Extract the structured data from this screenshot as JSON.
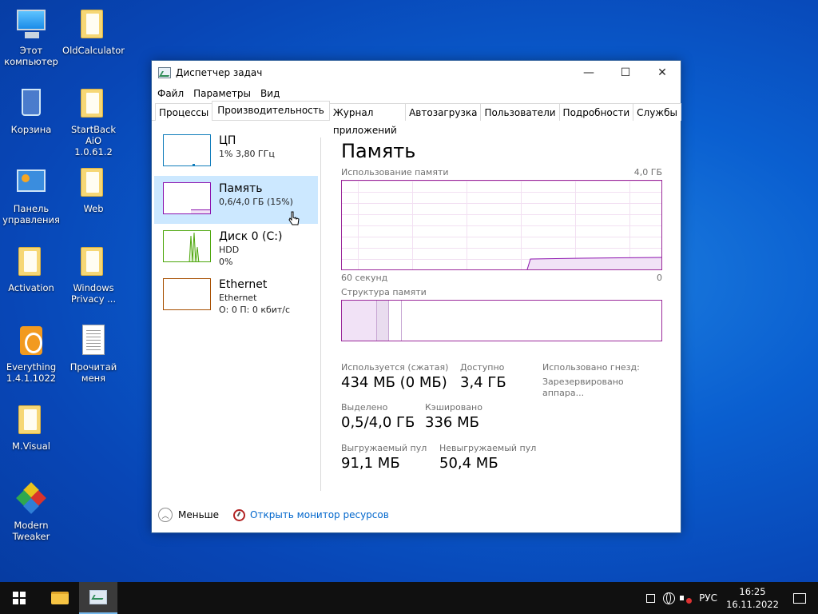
{
  "desktop": {
    "icons": [
      {
        "label_1": "Этот",
        "label_2": "компьютер"
      },
      {
        "label_1": "OldCalculator",
        "label_2": ""
      },
      {
        "label_1": "Корзина",
        "label_2": ""
      },
      {
        "label_1": "StartBack AiO",
        "label_2": "1.0.61.2"
      },
      {
        "label_1": "Панель",
        "label_2": "управления"
      },
      {
        "label_1": "Web",
        "label_2": ""
      },
      {
        "label_1": "Activation",
        "label_2": ""
      },
      {
        "label_1": "Windows",
        "label_2": "Privacy ..."
      },
      {
        "label_1": "Everything",
        "label_2": "1.4.1.1022"
      },
      {
        "label_1": "Прочитай",
        "label_2": "меня"
      },
      {
        "label_1": "M.Visual",
        "label_2": ""
      },
      {
        "label_1": "Modern",
        "label_2": "Tweaker"
      }
    ]
  },
  "window": {
    "title": "Диспетчер задач",
    "menu": [
      "Файл",
      "Параметры",
      "Вид"
    ],
    "tabs": [
      "Процессы",
      "Производительность",
      "Журнал приложений",
      "Автозагрузка",
      "Пользователи",
      "Подробности",
      "Службы"
    ],
    "active_tab": "Производительность",
    "controls": {
      "minimize": "—",
      "maximize": "☐",
      "close": "✕"
    }
  },
  "sidebar": {
    "items": [
      {
        "name": "ЦП",
        "sub1": "1% 3,80 ГГц",
        "sub2": "",
        "color": "#117dbb"
      },
      {
        "name": "Память",
        "sub1": "0,6/4,0 ГБ (15%)",
        "sub2": "",
        "color": "#8b12ae"
      },
      {
        "name": "Диск 0 (C:)",
        "sub1": "HDD",
        "sub2": "0%",
        "color": "#4da60c"
      },
      {
        "name": "Ethernet",
        "sub1": "Ethernet",
        "sub2": "О: 0 П: 0 кбит/с",
        "color": "#a74f01"
      }
    ],
    "selected_index": 1
  },
  "memory": {
    "title": "Память",
    "usage_label": "Использование памяти",
    "usage_max": "4,0 ГБ",
    "axis_left": "60 секунд",
    "axis_right": "0",
    "structure_label": "Структура памяти",
    "stats": {
      "in_use_label": "Используется (сжатая)",
      "in_use_value": "434 МБ (0 МБ)",
      "available_label": "Доступно",
      "available_value": "3,4 ГБ",
      "slots_label": "Использовано гнезд:",
      "reserved_label": "Зарезервировано аппара...",
      "committed_label": "Выделено",
      "committed_value": "0,5/4,0 ГБ",
      "cached_label": "Кэшировано",
      "cached_value": "336 МБ",
      "paged_label": "Выгружаемый пул",
      "paged_value": "91,1 МБ",
      "nonpaged_label": "Невыгружаемый пул",
      "nonpaged_value": "50,4 МБ"
    },
    "accent": "#8b12ae"
  },
  "footer": {
    "less": "Меньше",
    "monitor_link": "Открыть монитор ресурсов"
  },
  "taskbar": {
    "language": "РУС",
    "time": "16:25",
    "date": "16.11.2022"
  }
}
